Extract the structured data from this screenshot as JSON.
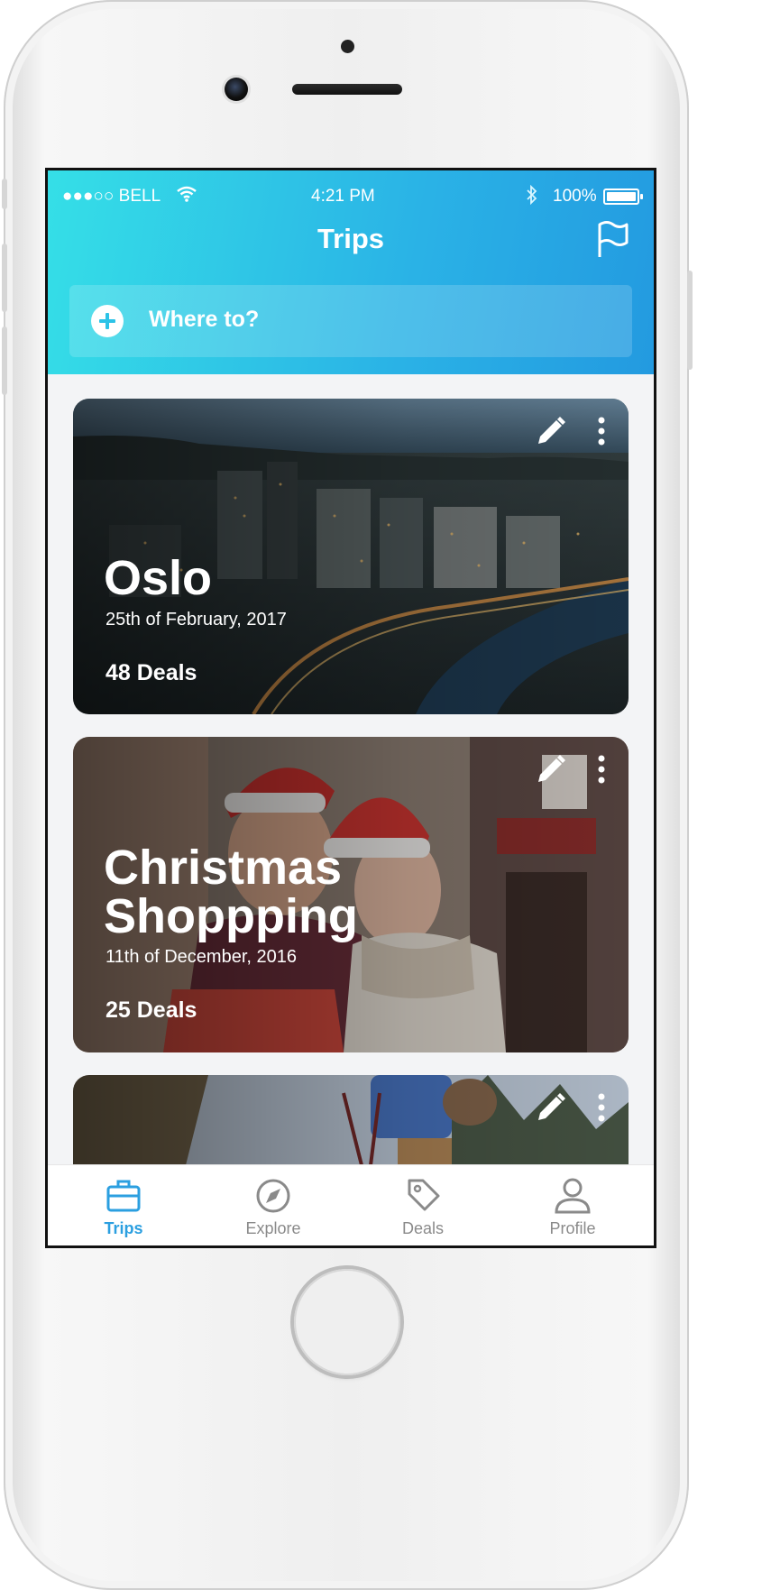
{
  "status_bar": {
    "carrier": "●●●○○ BELL",
    "time": "4:21 PM",
    "battery": "100%"
  },
  "header": {
    "title": "Trips",
    "search_placeholder": "Where to?"
  },
  "trips": [
    {
      "name": "Oslo",
      "date": "25th of February, 2017",
      "deals": "48 Deals"
    },
    {
      "name_line1": "Christmas",
      "name_line2": "Shoppping",
      "date": "11th of December, 2016",
      "deals": "25 Deals"
    }
  ],
  "tabs": [
    {
      "label": "Trips",
      "icon": "briefcase-icon",
      "active": true
    },
    {
      "label": "Explore",
      "icon": "compass-icon",
      "active": false
    },
    {
      "label": "Deals",
      "icon": "tag-icon",
      "active": false
    },
    {
      "label": "Profile",
      "icon": "person-icon",
      "active": false
    }
  ],
  "colors": {
    "header_start": "#35dfe7",
    "header_end": "#239ae0",
    "active_tab": "#2b9fe0",
    "inactive_tab": "#8a8a8a"
  }
}
